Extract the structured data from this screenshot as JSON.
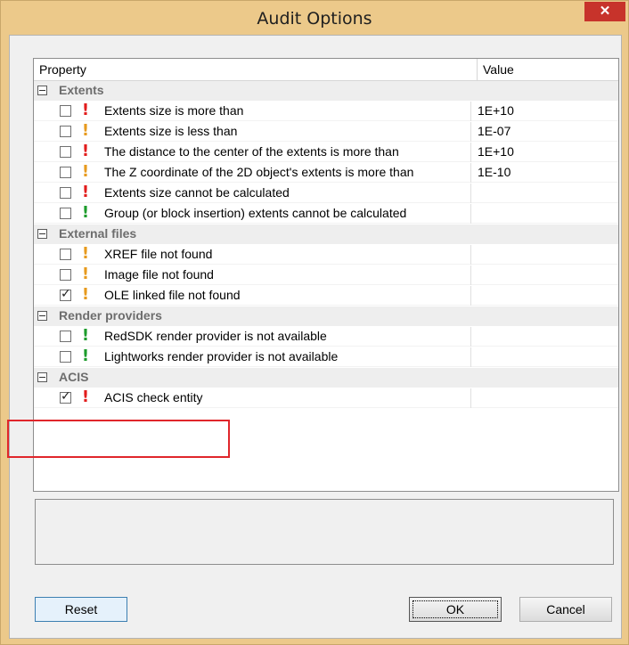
{
  "window": {
    "title": "Audit Options",
    "close_glyph": "✕"
  },
  "grid": {
    "headers": {
      "property": "Property",
      "value": "Value"
    },
    "categories": [
      {
        "label": "Extents",
        "items": [
          {
            "label": "Extents size is more than",
            "value": "1E+10",
            "severity": "red",
            "checked": false
          },
          {
            "label": "Extents size is less than",
            "value": "1E-07",
            "severity": "orange",
            "checked": false
          },
          {
            "label": "The distance to the center of the extents is more than",
            "value": "1E+10",
            "severity": "red",
            "checked": false
          },
          {
            "label": "The Z coordinate of the 2D object's extents is more than",
            "value": "1E-10",
            "severity": "orange",
            "checked": false
          },
          {
            "label": "Extents size cannot be calculated",
            "value": "",
            "severity": "red",
            "checked": false
          },
          {
            "label": "Group (or block insertion) extents cannot be calculated",
            "value": "",
            "severity": "green",
            "checked": false
          }
        ]
      },
      {
        "label": "External files",
        "items": [
          {
            "label": "XREF file not found",
            "value": "",
            "severity": "orange",
            "checked": false
          },
          {
            "label": "Image file not found",
            "value": "",
            "severity": "orange",
            "checked": false
          },
          {
            "label": "OLE linked file not found",
            "value": "",
            "severity": "orange",
            "checked": true
          }
        ]
      },
      {
        "label": "Render providers",
        "items": [
          {
            "label": "RedSDK render provider is not available",
            "value": "",
            "severity": "green",
            "checked": false
          },
          {
            "label": "Lightworks render provider is not available",
            "value": "",
            "severity": "green",
            "checked": false
          }
        ]
      },
      {
        "label": "ACIS",
        "items": [
          {
            "label": "ACIS check entity",
            "value": "",
            "severity": "red",
            "checked": true
          }
        ]
      }
    ]
  },
  "buttons": {
    "reset": "Reset",
    "ok": "OK",
    "cancel": "Cancel"
  },
  "severity_glyph": "!",
  "colors": {
    "severity_red": "#e21c1c",
    "severity_orange": "#e79a1e",
    "severity_green": "#1d9c2c",
    "highlight": "#e0262b"
  }
}
